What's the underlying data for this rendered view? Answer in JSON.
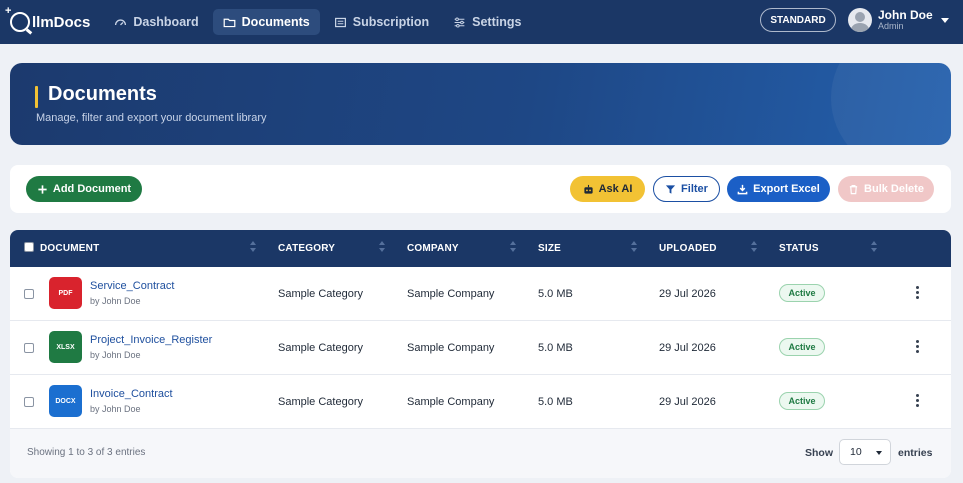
{
  "app": {
    "brand": "llmDocs"
  },
  "nav": [
    {
      "label": "Dashboard",
      "icon": "dashboard-icon"
    },
    {
      "label": "Documents",
      "icon": "folder-icon",
      "active": true
    },
    {
      "label": "Subscription",
      "icon": "subscription-icon"
    },
    {
      "label": "Settings",
      "icon": "sliders-icon"
    }
  ],
  "header": {
    "plan": "STANDARD",
    "user_name": "John Doe",
    "user_role": "Admin"
  },
  "hero": {
    "title": "Documents",
    "subtitle": "Manage, filter and export your document library"
  },
  "toolbar": {
    "add_label": "Add Document",
    "ask_ai_label": "Ask AI",
    "filter_label": "Filter",
    "export_label": "Export Excel",
    "bulk_delete_label": "Bulk Delete"
  },
  "table": {
    "columns": [
      "DOCUMENT",
      "CATEGORY",
      "COMPANY",
      "SIZE",
      "UPLOADED",
      "STATUS"
    ],
    "rows": [
      {
        "type": "PDF",
        "type_color": "#d9232d",
        "name": "Service_Contract",
        "by": "by John Doe",
        "category": "Sample Category",
        "company": "Sample Company",
        "size": "5.0 MB",
        "uploaded": "29 Jul 2026",
        "status": "Active"
      },
      {
        "type": "XLSX",
        "type_color": "#1f7a43",
        "name": "Project_Invoice_Register",
        "by": "by John Doe",
        "category": "Sample Category",
        "company": "Sample Company",
        "size": "5.0 MB",
        "uploaded": "29 Jul 2026",
        "status": "Active"
      },
      {
        "type": "DOCX",
        "type_color": "#1b6fd0",
        "name": "Invoice_Contract",
        "by": "by John Doe",
        "category": "Sample Category",
        "company": "Sample Company",
        "size": "5.0 MB",
        "uploaded": "29 Jul 2026",
        "status": "Active"
      }
    ]
  },
  "footer": {
    "info": "Showing 1 to 3 of 3 entries",
    "show_label": "Show",
    "entries_value": "10",
    "entries_label": "entries"
  }
}
